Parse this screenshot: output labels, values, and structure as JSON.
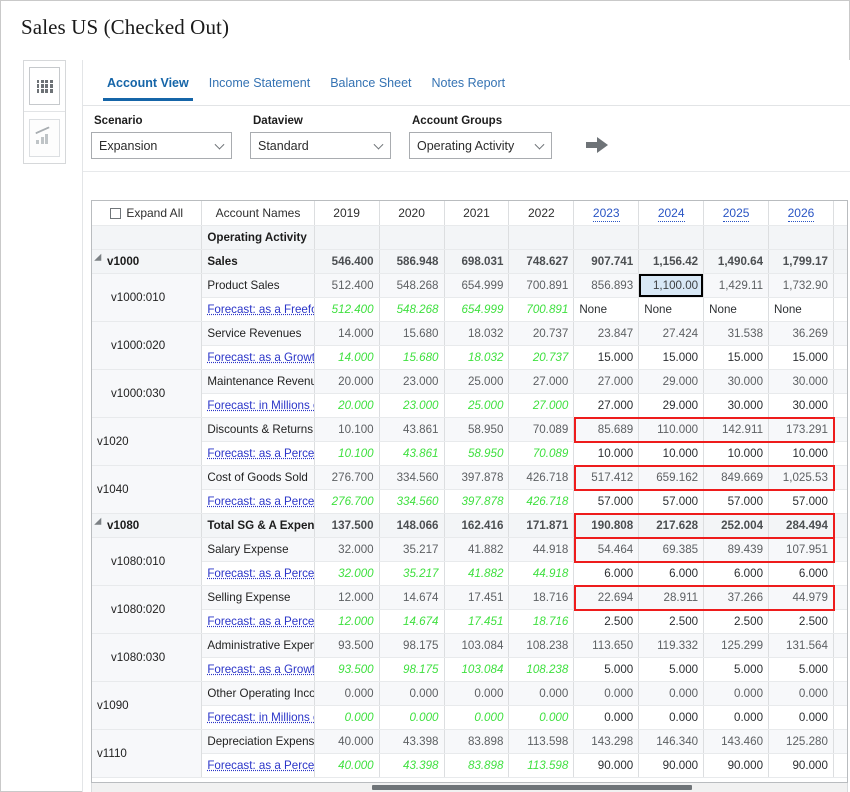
{
  "window": {
    "title": "Sales US (Checked Out)"
  },
  "rail": {
    "items": [
      {
        "icon": "grid-icon",
        "name": "grid-view-button",
        "active": true
      },
      {
        "icon": "chart-icon",
        "name": "chart-view-button",
        "active": false
      }
    ]
  },
  "tabs": [
    {
      "label": "Account View",
      "active": true
    },
    {
      "label": "Income Statement",
      "active": false
    },
    {
      "label": "Balance Sheet",
      "active": false
    },
    {
      "label": "Notes Report",
      "active": false
    }
  ],
  "filters": {
    "scenario": {
      "label": "Scenario",
      "value": "Expansion"
    },
    "dataview": {
      "label": "Dataview",
      "value": "Standard"
    },
    "account_groups": {
      "label": "Account Groups",
      "value": "Operating Activity"
    },
    "go_button": "go-arrow-icon"
  },
  "grid": {
    "headers": {
      "expand_all": "Expand All",
      "account_names": "Account Names",
      "years": [
        "2019",
        "2020",
        "2021",
        "2022",
        "2023",
        "2024",
        "2025",
        "2026"
      ],
      "forecast_years": [
        "2023",
        "2024",
        "2025",
        "2026"
      ]
    },
    "section_title": "Operating Activity",
    "selected_cell": {
      "row": "Product Sales",
      "year": "2024",
      "value": "1,100.00"
    },
    "rows": [
      {
        "code": "v1000",
        "expandable": true,
        "expanded": true,
        "indent": 0,
        "bold": true,
        "name": "Sales",
        "values": [
          "546.400",
          "586.948",
          "698.031",
          "748.627",
          "907.741",
          "1,156.42",
          "1,490.64",
          "1,799.17"
        ],
        "forecast": null
      },
      {
        "code": "v1000:010",
        "expandable": false,
        "indent": 1,
        "bold": false,
        "name": "Product Sales",
        "values": [
          "512.400",
          "548.268",
          "654.999",
          "700.891",
          "856.893",
          "1,100.00",
          "1,429.11",
          "1,732.90"
        ],
        "forecast": {
          "label": "Forecast: as a Freeform: U",
          "hist": [
            "512.400",
            "548.268",
            "654.999",
            "700.891"
          ],
          "fc": [
            "None",
            "None",
            "None",
            "None"
          ],
          "fc_align": "left"
        }
      },
      {
        "code": "v1000:020",
        "expandable": false,
        "indent": 1,
        "bold": false,
        "name": "Service Revenues",
        "values": [
          "14.000",
          "15.680",
          "18.032",
          "20.737",
          "23.847",
          "27.424",
          "31.538",
          "36.269"
        ],
        "forecast": {
          "label": "Forecast: as a Growth Rat",
          "hist": [
            "14.000",
            "15.680",
            "18.032",
            "20.737"
          ],
          "fc": [
            "15.000",
            "15.000",
            "15.000",
            "15.000"
          ]
        }
      },
      {
        "code": "v1000:030",
        "expandable": false,
        "indent": 1,
        "bold": false,
        "name": "Maintenance Revenue",
        "values": [
          "20.000",
          "23.000",
          "25.000",
          "27.000",
          "27.000",
          "29.000",
          "30.000",
          "30.000"
        ],
        "forecast": {
          "label": "Forecast: in Millions of US",
          "hist": [
            "20.000",
            "23.000",
            "25.000",
            "27.000"
          ],
          "fc": [
            "27.000",
            "29.000",
            "30.000",
            "30.000"
          ]
        }
      },
      {
        "code": "v1020",
        "expandable": false,
        "indent": 0,
        "bold": false,
        "name": "Discounts & Returns",
        "values": [
          "10.100",
          "43.861",
          "58.950",
          "70.089",
          "85.689",
          "110.000",
          "142.911",
          "173.291"
        ],
        "highlight": true,
        "forecast": {
          "label": "Forecast: as a Percent of F",
          "hist": [
            "10.100",
            "43.861",
            "58.950",
            "70.089"
          ],
          "fc": [
            "10.000",
            "10.000",
            "10.000",
            "10.000"
          ]
        }
      },
      {
        "code": "v1040",
        "expandable": false,
        "indent": 0,
        "bold": false,
        "name": "Cost of Goods Sold",
        "values": [
          "276.700",
          "334.560",
          "397.878",
          "426.718",
          "517.412",
          "659.162",
          "849.669",
          "1,025.53"
        ],
        "highlight": true,
        "forecast": {
          "label": "Forecast: as a Percent of S",
          "hist": [
            "276.700",
            "334.560",
            "397.878",
            "426.718"
          ],
          "fc": [
            "57.000",
            "57.000",
            "57.000",
            "57.000"
          ]
        }
      },
      {
        "code": "v1080",
        "expandable": true,
        "expanded": true,
        "indent": 0,
        "bold": true,
        "name": "Total SG & A Expense",
        "values": [
          "137.500",
          "148.066",
          "162.416",
          "171.871",
          "190.808",
          "217.628",
          "252.004",
          "284.494"
        ],
        "highlight": true,
        "forecast": null
      },
      {
        "code": "v1080:010",
        "expandable": false,
        "indent": 1,
        "bold": false,
        "name": "Salary Expense",
        "values": [
          "32.000",
          "35.217",
          "41.882",
          "44.918",
          "54.464",
          "69.385",
          "89.439",
          "107.951"
        ],
        "highlight": true,
        "forecast": {
          "label": "Forecast: as a Percent of S",
          "hist": [
            "32.000",
            "35.217",
            "41.882",
            "44.918"
          ],
          "fc": [
            "6.000",
            "6.000",
            "6.000",
            "6.000"
          ]
        }
      },
      {
        "code": "v1080:020",
        "expandable": false,
        "indent": 1,
        "bold": false,
        "name": "Selling Expense",
        "values": [
          "12.000",
          "14.674",
          "17.451",
          "18.716",
          "22.694",
          "28.911",
          "37.266",
          "44.979"
        ],
        "highlight": true,
        "forecast": {
          "label": "Forecast: as a Percent of S",
          "hist": [
            "12.000",
            "14.674",
            "17.451",
            "18.716"
          ],
          "fc": [
            "2.500",
            "2.500",
            "2.500",
            "2.500"
          ]
        }
      },
      {
        "code": "v1080:030",
        "expandable": false,
        "indent": 1,
        "bold": false,
        "name": "Administrative Expenses",
        "values": [
          "93.500",
          "98.175",
          "103.084",
          "108.238",
          "113.650",
          "119.332",
          "125.299",
          "131.564"
        ],
        "forecast": {
          "label": "Forecast: as a Growth Rat",
          "hist": [
            "93.500",
            "98.175",
            "103.084",
            "108.238"
          ],
          "fc": [
            "5.000",
            "5.000",
            "5.000",
            "5.000"
          ]
        }
      },
      {
        "code": "v1090",
        "expandable": false,
        "indent": 0,
        "bold": false,
        "name": "Other Operating Income/(E",
        "values": [
          "0.000",
          "0.000",
          "0.000",
          "0.000",
          "0.000",
          "0.000",
          "0.000",
          "0.000"
        ],
        "forecast": {
          "label": "Forecast: in Millions of US",
          "hist": [
            "0.000",
            "0.000",
            "0.000",
            "0.000"
          ],
          "fc": [
            "0.000",
            "0.000",
            "0.000",
            "0.000"
          ]
        }
      },
      {
        "code": "v1110",
        "expandable": false,
        "indent": 0,
        "bold": false,
        "name": "Depreciation Expense",
        "values": [
          "40.000",
          "43.398",
          "83.898",
          "113.598",
          "143.298",
          "146.340",
          "143.460",
          "125.280"
        ],
        "forecast": {
          "label": "Forecast: as a Percent of D",
          "hist": [
            "40.000",
            "43.398",
            "83.898",
            "113.598"
          ],
          "fc": [
            "90.000",
            "90.000",
            "90.000",
            "90.000"
          ]
        }
      }
    ]
  },
  "colors": {
    "accent": "#1565a8",
    "link": "#3573b3",
    "forecast_link": "#2a34c8",
    "historical_green": "#3fe03f",
    "annotation_red": "#ee1c1c",
    "selection_fill": "#d8e8f6"
  }
}
